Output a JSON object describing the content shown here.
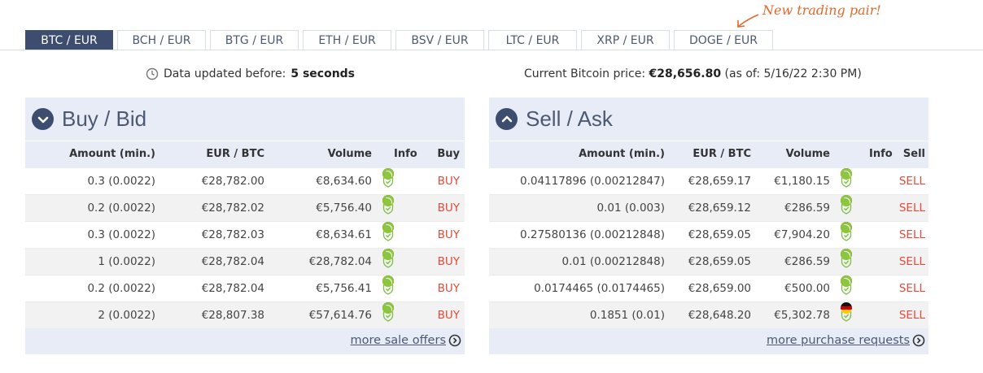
{
  "tabs": [
    {
      "label": "BTC / EUR",
      "active": true
    },
    {
      "label": "BCH / EUR",
      "active": false
    },
    {
      "label": "BTG / EUR",
      "active": false
    },
    {
      "label": "ETH / EUR",
      "active": false
    },
    {
      "label": "BSV / EUR",
      "active": false
    },
    {
      "label": "LTC / EUR",
      "active": false
    },
    {
      "label": "XRP / EUR",
      "active": false
    },
    {
      "label": "DOGE / EUR",
      "active": false
    }
  ],
  "annotation": "New trading pair!",
  "status": {
    "updated_label": "Data updated before:",
    "updated_value": "5 seconds",
    "price_label": "Current Bitcoin price:",
    "price_value": "€28,656.80",
    "price_asof": "(as of: 5/16/22 2:30 PM)"
  },
  "buy": {
    "title": "Buy / Bid",
    "columns": [
      "Amount (min.)",
      "EUR / BTC",
      "Volume",
      "Info",
      "Buy"
    ],
    "rows": [
      {
        "amount": "0.3 (0.0022)",
        "price": "€28,782.00",
        "volume": "€8,634.60",
        "action": "BUY",
        "leaf": true
      },
      {
        "amount": "0.2 (0.0022)",
        "price": "€28,782.02",
        "volume": "€5,756.40",
        "action": "BUY",
        "leaf": true
      },
      {
        "amount": "0.3 (0.0022)",
        "price": "€28,782.03",
        "volume": "€8,634.61",
        "action": "BUY",
        "leaf": true
      },
      {
        "amount": "1 (0.0022)",
        "price": "€28,782.04",
        "volume": "€28,782.04",
        "action": "BUY",
        "leaf": true
      },
      {
        "amount": "0.2 (0.0022)",
        "price": "€28,782.04",
        "volume": "€5,756.41",
        "action": "BUY",
        "leaf": true
      },
      {
        "amount": "2 (0.0022)",
        "price": "€28,807.38",
        "volume": "€57,614.76",
        "action": "BUY",
        "leaf": true
      }
    ],
    "more": "more sale offers"
  },
  "sell": {
    "title": "Sell / Ask",
    "columns": [
      "Amount (min.)",
      "EUR / BTC",
      "Volume",
      "Info",
      "Sell"
    ],
    "rows": [
      {
        "amount": "0.04117896 (0.00212847)",
        "price": "€28,659.17",
        "volume": "€1,180.15",
        "action": "SELL",
        "leaf": true
      },
      {
        "amount": "0.01 (0.003)",
        "price": "€28,659.12",
        "volume": "€286.59",
        "action": "SELL",
        "leaf": true
      },
      {
        "amount": "0.27580136 (0.00212848)",
        "price": "€28,659.05",
        "volume": "€7,904.20",
        "action": "SELL",
        "leaf": true
      },
      {
        "amount": "0.01 (0.00212848)",
        "price": "€28,659.05",
        "volume": "€286.59",
        "action": "SELL",
        "leaf": true
      },
      {
        "amount": "0.0174465 (0.0174465)",
        "price": "€28,659.00",
        "volume": "€500.00",
        "action": "SELL",
        "leaf": true
      },
      {
        "amount": "0.1851 (0.01)",
        "price": "€28,648.20",
        "volume": "€5,302.78",
        "action": "SELL",
        "leaf": false
      }
    ],
    "more": "more purchase requests"
  },
  "colors": {
    "navy": "#3d4d6f",
    "panel": "#e7ecf6",
    "buy_red": "#e24b3b",
    "note": "#e0692f"
  }
}
